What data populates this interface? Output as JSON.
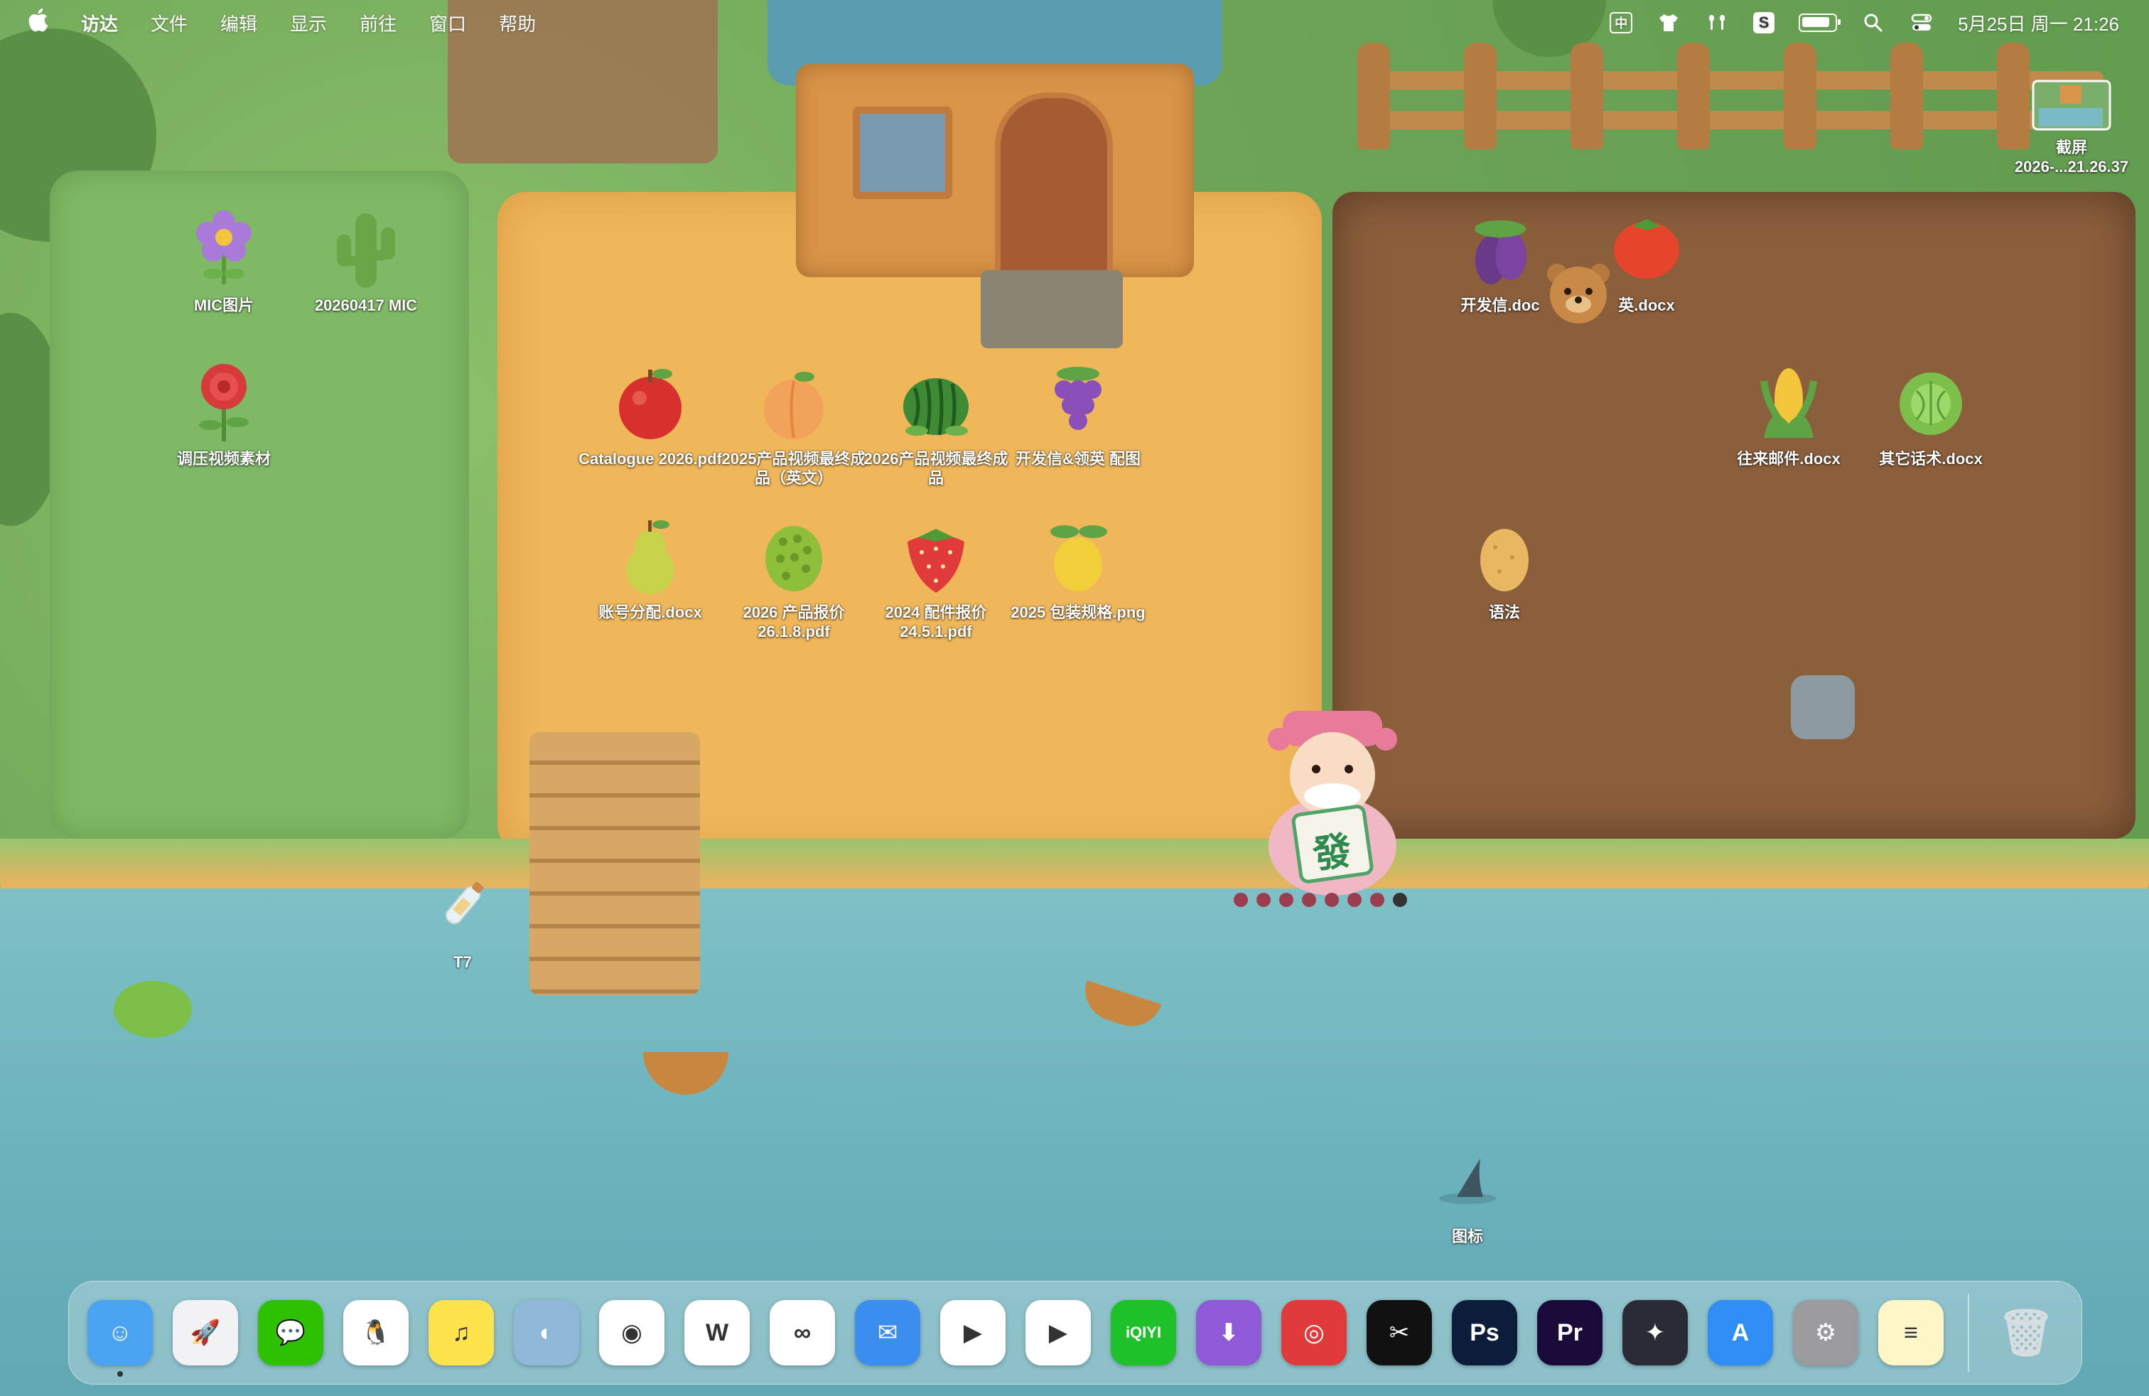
{
  "menubar": {
    "app_name": "访达",
    "menus": [
      "文件",
      "编辑",
      "显示",
      "前往",
      "窗口",
      "帮助"
    ],
    "ime_label": "中",
    "sogou_label": "S",
    "clock": "5月25日 周一 21:26"
  },
  "desktop": {
    "screenshot_icon": {
      "line1": "截屏",
      "line2": "2026-...21.26.37"
    },
    "icons": [
      {
        "id": "mic-pictures",
        "label": "MIC图片",
        "art": "purple-flower"
      },
      {
        "id": "mic-20260417",
        "label": "20260417 MIC",
        "art": "cactus"
      },
      {
        "id": "video-material",
        "label": "调压视频素材",
        "art": "red-rose"
      },
      {
        "id": "catalogue",
        "label": "Catalogue 2026.pdf",
        "art": "apple"
      },
      {
        "id": "video-final-en",
        "label": "2025产品视频最终成品（英文）",
        "art": "peach"
      },
      {
        "id": "video-final-2026",
        "label": "2026产品视频最终成品",
        "art": "watermelon"
      },
      {
        "id": "kaifaxin-images",
        "label": "开发信&领英 配图",
        "art": "grapes"
      },
      {
        "id": "account-docx",
        "label": "账号分配.docx",
        "art": "pear"
      },
      {
        "id": "quote-2026",
        "label": "2026 产品报价26.1.8.pdf",
        "art": "durian"
      },
      {
        "id": "parts-quote-2024",
        "label": "2024 配件报价24.5.1.pdf",
        "art": "strawberry"
      },
      {
        "id": "packaging-2025",
        "label": "2025 包装规格.png",
        "art": "lemon"
      },
      {
        "id": "kaifaxin-docx",
        "label": "开发信.doc",
        "art": "eggplant"
      },
      {
        "id": "linkedin-docx",
        "label": "英.docx",
        "art": "tomato"
      },
      {
        "id": "mail-docx",
        "label": "往来邮件.docx",
        "art": "corn"
      },
      {
        "id": "talk-docx",
        "label": "其它话术.docx",
        "art": "cabbage"
      },
      {
        "id": "grammar",
        "label": "语法",
        "art": "potato"
      },
      {
        "id": "t7-drive",
        "label": "T7",
        "art": "bottle"
      },
      {
        "id": "logo-folder",
        "label": "图标",
        "art": "shark-fin"
      }
    ]
  },
  "pet": {
    "badge_char": "發"
  },
  "dock": {
    "apps": [
      {
        "id": "finder",
        "color": "#4aa3f0",
        "glyph": "☺",
        "running": true
      },
      {
        "id": "launchpad",
        "color": "#f2f2f5",
        "glyph": "🚀",
        "running": false
      },
      {
        "id": "wechat",
        "color": "#2dc100",
        "glyph": "💬",
        "running": false
      },
      {
        "id": "qq",
        "color": "#ffffff",
        "glyph": "🐧",
        "running": false
      },
      {
        "id": "qq-music",
        "color": "#ffe34d",
        "glyph": "♫",
        "running": false
      },
      {
        "id": "qq-browser",
        "color": "#8fb8d8",
        "glyph": "◐",
        "running": false
      },
      {
        "id": "chrome",
        "color": "#ffffff",
        "glyph": "◉",
        "running": false
      },
      {
        "id": "wps",
        "color": "#ffffff",
        "glyph": "W",
        "running": false
      },
      {
        "id": "baidu-netdisk",
        "color": "#ffffff",
        "glyph": "∞",
        "running": false
      },
      {
        "id": "feishu-chat",
        "color": "#3a8ef0",
        "glyph": "✉",
        "running": false
      },
      {
        "id": "prompt-app",
        "color": "#ffffff",
        "glyph": "▶",
        "running": false
      },
      {
        "id": "tencent-video",
        "color": "#ffffff",
        "glyph": "▶",
        "running": false
      },
      {
        "id": "iqiyi",
        "color": "#1fc12b",
        "glyph": "iQIYI",
        "running": false
      },
      {
        "id": "downie",
        "color": "#8e5ad8",
        "glyph": "⬇",
        "running": false
      },
      {
        "id": "netease-music",
        "color": "#e03a3a",
        "glyph": "◎",
        "running": false
      },
      {
        "id": "capcut",
        "color": "#111111",
        "glyph": "✂",
        "running": false
      },
      {
        "id": "photoshop",
        "color": "#0b1d3a",
        "glyph": "Ps",
        "running": false
      },
      {
        "id": "premiere",
        "color": "#1a0a3a",
        "glyph": "Pr",
        "running": false
      },
      {
        "id": "davinci",
        "color": "#2b2b35",
        "glyph": "✦",
        "running": false
      },
      {
        "id": "app-store",
        "color": "#2f8df5",
        "glyph": "A",
        "running": false
      },
      {
        "id": "system-settings",
        "color": "#9a9a9f",
        "glyph": "⚙",
        "running": false
      },
      {
        "id": "notes",
        "color": "#fff6c8",
        "glyph": "≡",
        "running": false
      }
    ],
    "trash_glyph": "🗑"
  }
}
